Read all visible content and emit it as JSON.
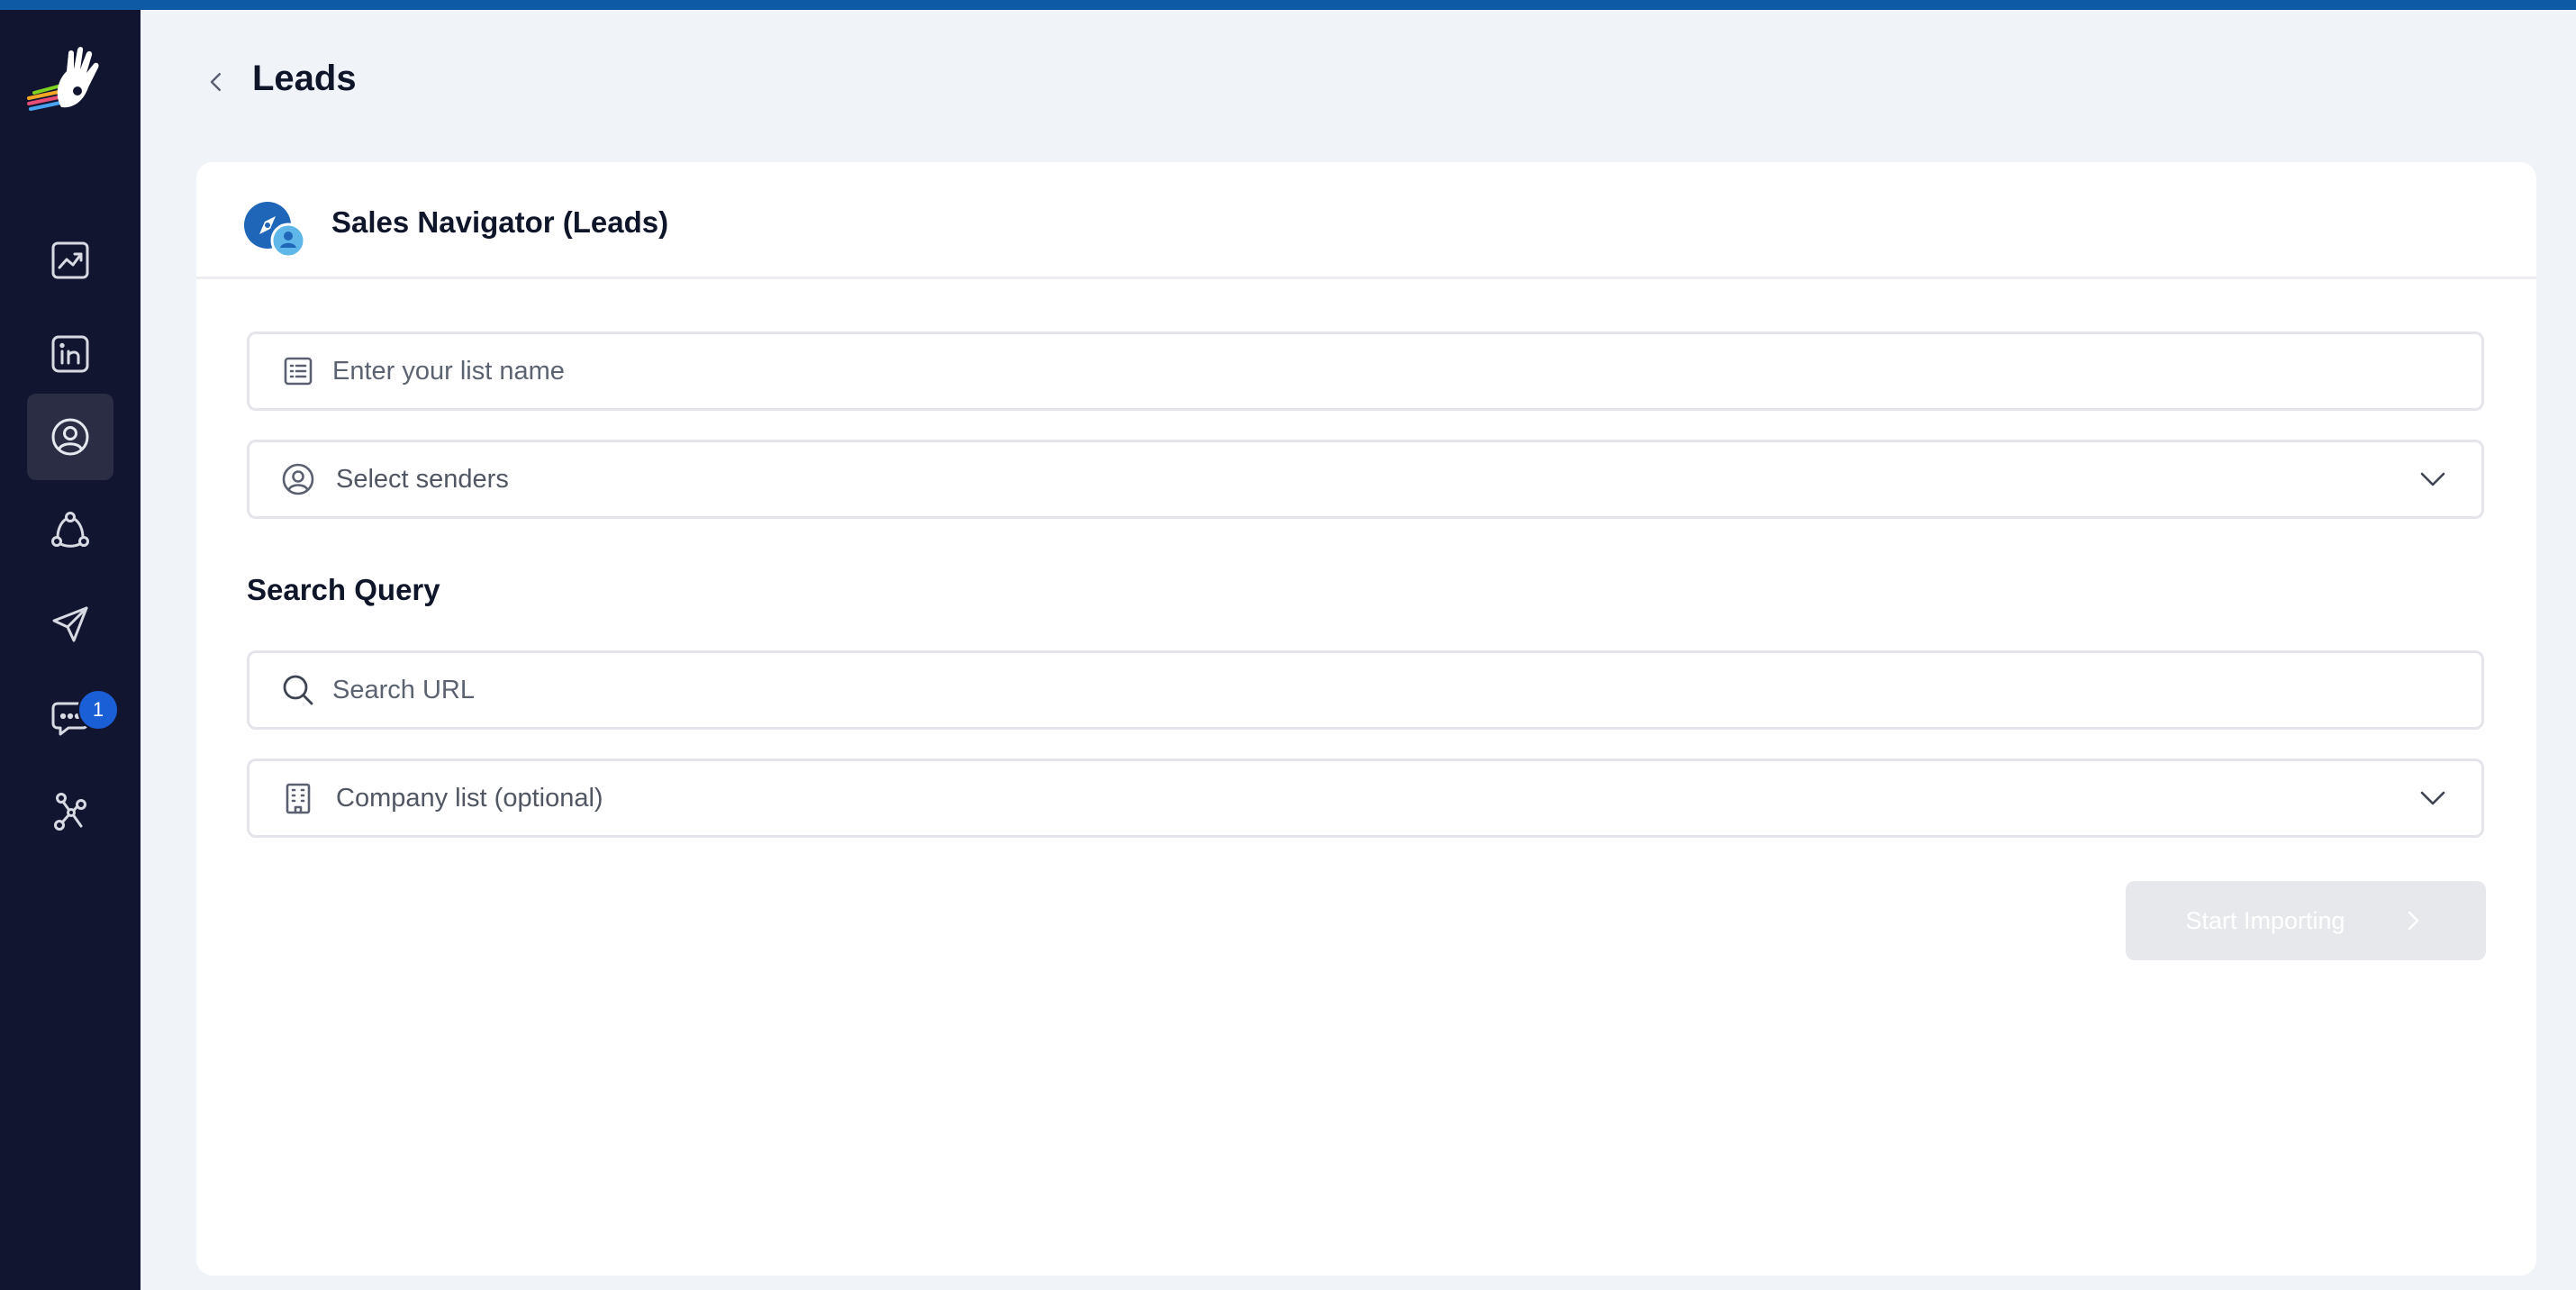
{
  "page": {
    "title": "Leads"
  },
  "sidebar": {
    "items": [
      {
        "name": "analytics",
        "icon": "trend-chart-icon"
      },
      {
        "name": "linkedin",
        "icon": "linkedin-icon"
      },
      {
        "name": "leads",
        "icon": "user-circle-icon",
        "active": true
      },
      {
        "name": "campaigns",
        "icon": "network-icon"
      },
      {
        "name": "outreach",
        "icon": "paper-plane-icon"
      },
      {
        "name": "inbox",
        "icon": "chat-icon",
        "badge": "1"
      },
      {
        "name": "integrations",
        "icon": "webhook-icon"
      }
    ]
  },
  "card": {
    "title": "Sales Navigator (Leads)",
    "list_name_placeholder": "Enter your list name",
    "senders_label": "Select senders",
    "search_section_title": "Search Query",
    "search_url_placeholder": "Search URL",
    "company_list_label": "Company list (optional)",
    "start_button": "Start Importing"
  },
  "colors": {
    "sidebar_bg": "#121530",
    "topbar": "#0e5aa4",
    "badge": "#1b5fd6",
    "disabled_button": "#e6e8ec"
  }
}
